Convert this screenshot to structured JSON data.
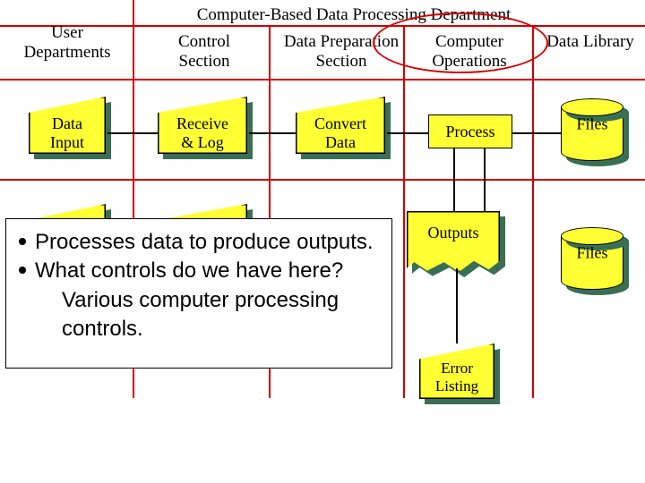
{
  "headers": {
    "user_depts": "User\nDepartments",
    "cb_dept": "Computer-Based Data Processing Department",
    "control": "Control\nSection",
    "data_prep": "Data Preparation\nSection",
    "comp_ops": "Computer\nOperations",
    "data_library": "Data   Library"
  },
  "shapes": {
    "data_input": "Data\nInput",
    "receive_log": "Receive\n& Log",
    "convert_data": "Convert\nData",
    "process": "Process",
    "files_top": "Files",
    "outputs": "Outputs",
    "files_bottom": "Files",
    "error_listing": "Error\nListing"
  },
  "caption": {
    "b1": "Processes data to produce outputs.",
    "b2": "What controls do we have here?",
    "sub": "Various computer processing controls."
  }
}
